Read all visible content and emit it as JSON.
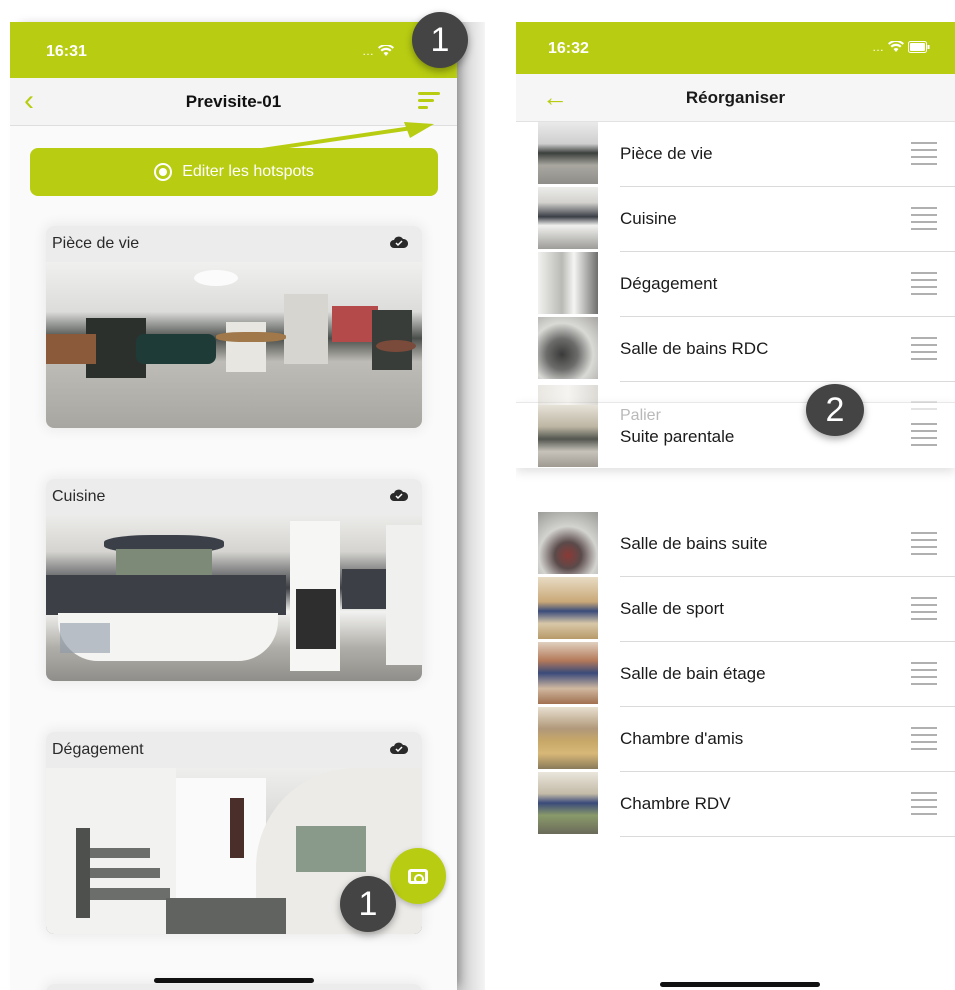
{
  "left_screen": {
    "time": "16:31",
    "title": "Previsite-01",
    "edit_hotspots_label": "Editer les hotspots",
    "cards": [
      {
        "title": "Pièce de vie"
      },
      {
        "title": "Cuisine"
      },
      {
        "title": "Dégagement"
      }
    ],
    "marker_top": "1",
    "marker_bottom": "1"
  },
  "right_screen": {
    "time": "16:32",
    "title": "Réorganiser",
    "rows_top": [
      {
        "label": "Pièce de vie"
      },
      {
        "label": "Cuisine"
      },
      {
        "label": "Dégagement"
      },
      {
        "label": "Salle de bains RDC"
      }
    ],
    "drag_ghost_label": "Palier",
    "drag_label": "Suite parentale",
    "marker": "2",
    "rows_bottom": [
      {
        "label": "Salle de bains suite"
      },
      {
        "label": "Salle de sport"
      },
      {
        "label": "Salle de bain étage"
      },
      {
        "label": "Chambre d'amis"
      },
      {
        "label": "Chambre RDV"
      }
    ]
  },
  "colors": {
    "accent": "#b8cd12",
    "marker": "#444444"
  },
  "icons": {
    "sort": "sort-lines-icon",
    "back_left": "chevron-left-icon",
    "back_right": "arrow-left-icon",
    "cloud": "cloud-check-icon",
    "camera": "camera-icon",
    "drag": "drag-handle-icon"
  }
}
